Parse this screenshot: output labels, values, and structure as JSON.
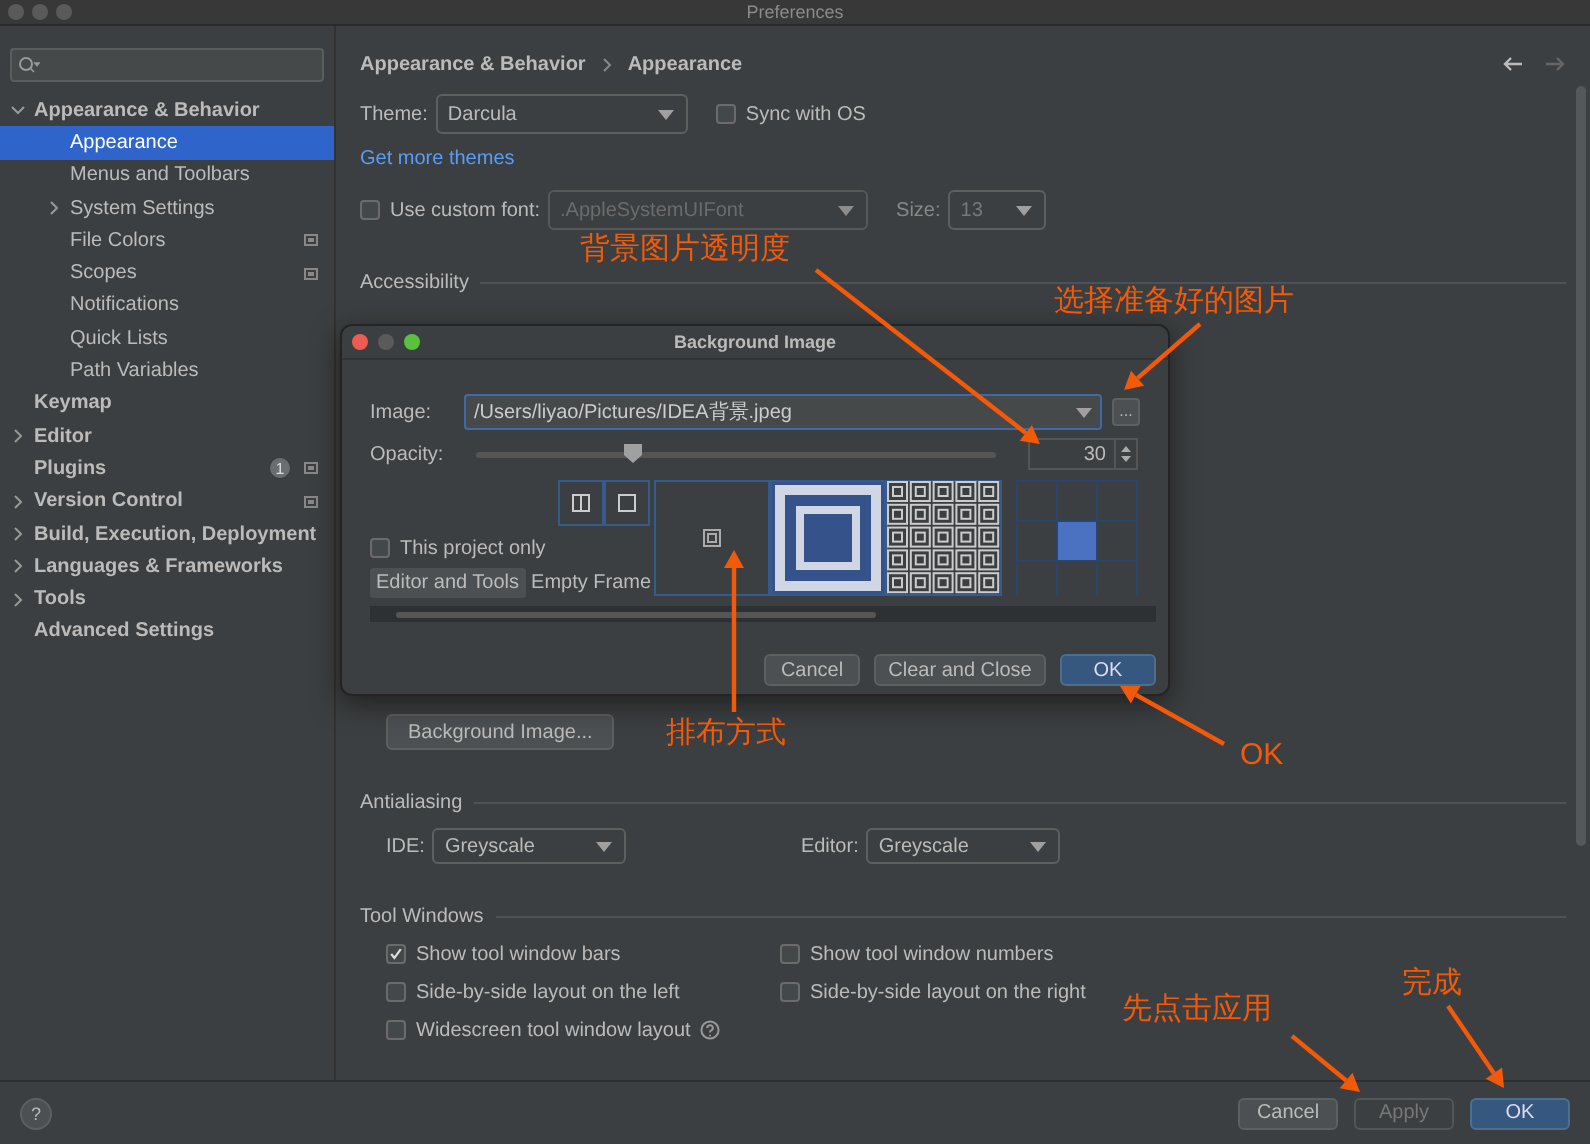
{
  "window": {
    "title": "Preferences"
  },
  "sidebar": {
    "items": [
      {
        "label": "Appearance & Behavior",
        "expanded": true,
        "selected": false,
        "project_level": false,
        "children": [
          {
            "label": "Appearance",
            "selected": true,
            "project_level": false
          },
          {
            "label": "Menus and Toolbars",
            "selected": false,
            "project_level": false
          },
          {
            "label": "System Settings",
            "expanded": false,
            "selected": false,
            "project_level": false
          },
          {
            "label": "File Colors",
            "selected": false,
            "project_level": true
          },
          {
            "label": "Scopes",
            "selected": false,
            "project_level": true
          },
          {
            "label": "Notifications",
            "selected": false,
            "project_level": false
          },
          {
            "label": "Quick Lists",
            "selected": false,
            "project_level": false
          },
          {
            "label": "Path Variables",
            "selected": false,
            "project_level": false
          }
        ]
      },
      {
        "label": "Keymap",
        "selected": false,
        "project_level": false
      },
      {
        "label": "Editor",
        "expanded": false,
        "selected": false,
        "project_level": false
      },
      {
        "label": "Plugins",
        "selected": false,
        "project_level": true,
        "badge": "1"
      },
      {
        "label": "Version Control",
        "expanded": false,
        "selected": false,
        "project_level": true
      },
      {
        "label": "Build, Execution, Deployment",
        "expanded": false,
        "selected": false,
        "project_level": false
      },
      {
        "label": "Languages & Frameworks",
        "expanded": false,
        "selected": false,
        "project_level": false
      },
      {
        "label": "Tools",
        "expanded": false,
        "selected": false,
        "project_level": false
      },
      {
        "label": "Advanced Settings",
        "selected": false,
        "project_level": false
      }
    ]
  },
  "breadcrumb": [
    "Appearance & Behavior",
    "Appearance"
  ],
  "theme": {
    "label": "Theme:",
    "value": "Darcula",
    "sync_label": "Sync with OS",
    "sync_checked": false
  },
  "more_themes_link": "Get more themes",
  "custom_font": {
    "label": "Use custom font:",
    "checked": false,
    "font": ".AppleSystemUIFont",
    "size_label": "Size:",
    "size": "13"
  },
  "accessibility": {
    "heading": "Accessibility"
  },
  "background_button": "Background Image...",
  "antialiasing": {
    "heading": "Antialiasing",
    "ide_label": "IDE:",
    "ide_value": "Greyscale",
    "editor_label": "Editor:",
    "editor_value": "Greyscale"
  },
  "tool_windows": {
    "heading": "Tool Windows",
    "options": [
      {
        "label": "Show tool window bars",
        "checked": true
      },
      {
        "label": "Show tool window numbers",
        "checked": false
      },
      {
        "label": "Side-by-side layout on the left",
        "checked": false
      },
      {
        "label": "Side-by-side layout on the right",
        "checked": false
      },
      {
        "label": "Widescreen tool window layout",
        "checked": false,
        "help": true
      }
    ]
  },
  "footer": {
    "help_label": "?",
    "buttons": [
      {
        "label": "Cancel",
        "kind": "normal",
        "disabled": false
      },
      {
        "label": "Apply",
        "kind": "normal",
        "disabled": true
      },
      {
        "label": "OK",
        "kind": "default",
        "disabled": false
      }
    ]
  },
  "dialog": {
    "title": "Background Image",
    "image_label": "Image:",
    "image_path": "/Users/liyao/Pictures/IDEA背景.jpeg",
    "browse": "...",
    "opacity_label": "Opacity:",
    "opacity": {
      "level": 0.3,
      "reading": "30"
    },
    "this_project_only": {
      "label": "This project only",
      "checked": false
    },
    "tabs": [
      {
        "label": "Editor and Tools",
        "selected": true
      },
      {
        "label": "Empty Frame",
        "selected": false
      }
    ],
    "fill_modes": [
      {
        "kind": "center",
        "selected": false
      },
      {
        "kind": "scale",
        "selected": true
      },
      {
        "kind": "tile",
        "selected": false
      }
    ],
    "anchor_cells": [
      {
        "selected": false
      },
      {
        "selected": false
      },
      {
        "selected": false
      },
      {
        "selected": false
      },
      {
        "selected": true
      },
      {
        "selected": false
      },
      {
        "selected": false
      },
      {
        "selected": false
      },
      {
        "selected": false
      }
    ],
    "buttons": [
      {
        "label": "Cancel",
        "kind": "normal"
      },
      {
        "label": "Clear and Close",
        "kind": "normal"
      },
      {
        "label": "OK",
        "kind": "default"
      }
    ]
  },
  "annotations": [
    {
      "text": "背景图片透明度"
    },
    {
      "text": "选择准备好的图片"
    },
    {
      "text": "排布方式"
    },
    {
      "text": "OK"
    },
    {
      "text": "先点击应用"
    },
    {
      "text": "完成"
    }
  ]
}
